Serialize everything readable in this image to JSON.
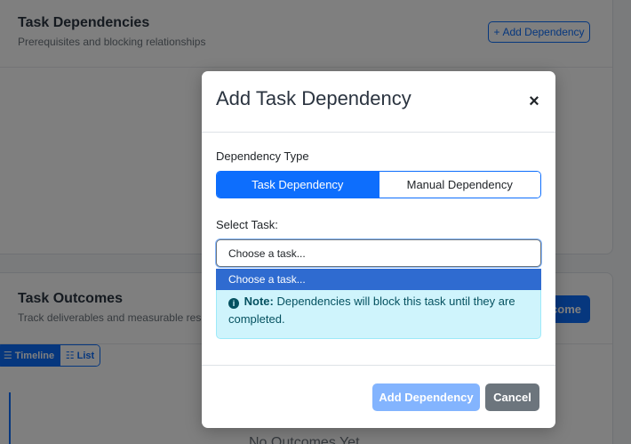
{
  "background": {
    "dependencies_card": {
      "title": "Task Dependencies",
      "subtitle": "Prerequisites and blocking relationships",
      "add_button_label": "Add Dependency"
    },
    "outcomes_card": {
      "title": "Task Outcomes",
      "subtitle": "Track deliverables and measurable results",
      "add_button_partial": "tcome",
      "view_toggle": {
        "timeline": "Timeline",
        "list": "List"
      },
      "empty_text": "No Outcomes Yet"
    }
  },
  "modal": {
    "title": "Add Task Dependency",
    "close_glyph": "×",
    "dependency_type_label": "Dependency Type",
    "type_options": [
      "Task Dependency",
      "Manual Dependency"
    ],
    "selected_type": "Task Dependency",
    "select_task_label": "Select Task:",
    "select_value": "Choose a task...",
    "dropdown_options": [
      "Choose a task..."
    ],
    "note_label": "Note:",
    "note_text": "Dependencies will block this task until they are completed.",
    "add_button": "Add Dependency",
    "cancel_button": "Cancel"
  },
  "colors": {
    "primary": "#0d6efd",
    "info_bg": "#cff4fc",
    "secondary": "#6c757d",
    "dropdown_highlight": "#2f6bd0"
  },
  "icons": [
    "plus-icon",
    "timeline-icon",
    "list-icon",
    "info-circle-icon",
    "close-icon"
  ]
}
